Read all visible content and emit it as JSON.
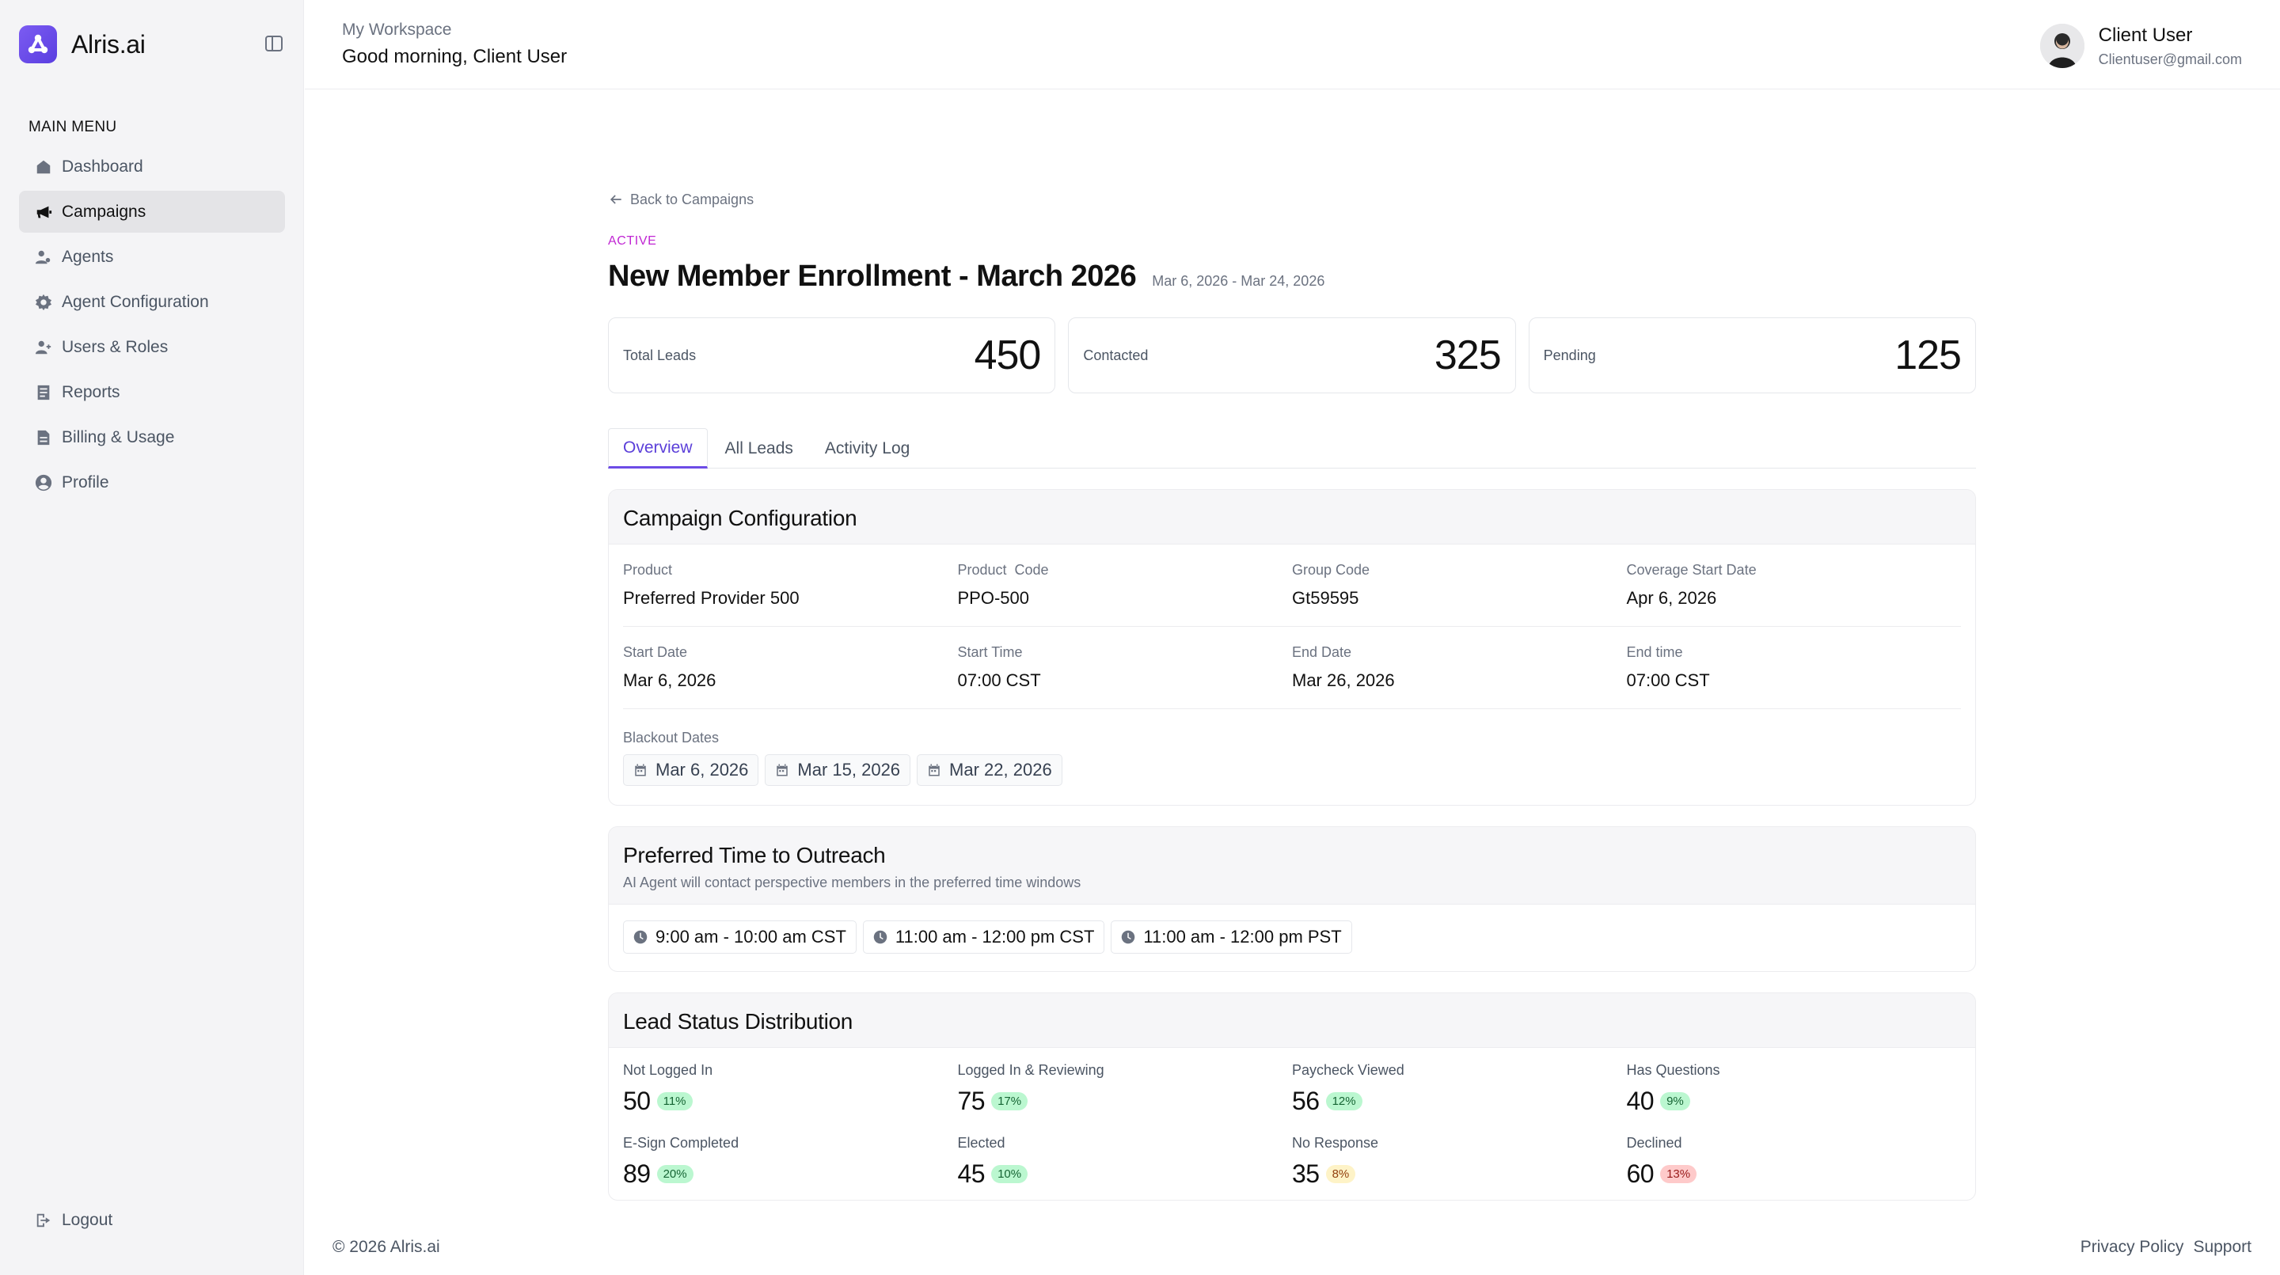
{
  "brand": {
    "name": "Alris.ai",
    "logo_icon": "triangle-dots-icon",
    "accent": "#6d4ce6"
  },
  "sidebar": {
    "menu_title": "MAIN MENU",
    "items": [
      {
        "label": "Dashboard",
        "icon": "home-icon"
      },
      {
        "label": "Campaigns",
        "icon": "megaphone-icon",
        "active": true
      },
      {
        "label": "Agents",
        "icon": "agents-icon"
      },
      {
        "label": "Agent Configuration",
        "icon": "gear-icon"
      },
      {
        "label": "Users & Roles",
        "icon": "users-icon"
      },
      {
        "label": "Reports",
        "icon": "report-icon"
      },
      {
        "label": "Billing & Usage",
        "icon": "billing-icon"
      },
      {
        "label": "Profile",
        "icon": "profile-icon"
      }
    ],
    "logout": "Logout"
  },
  "header": {
    "workspace": "My Workspace",
    "greeting": "Good morning, Client User",
    "user_name": "Client User",
    "user_email": "Clientuser@gmail.com"
  },
  "campaign": {
    "back": "Back to Campaigns",
    "status": "ACTIVE",
    "title": "New Member Enrollment - March 2026",
    "date_range": "Mar 6, 2026 - Mar 24, 2026",
    "stats": [
      {
        "label": "Total Leads",
        "value": "450"
      },
      {
        "label": "Contacted",
        "value": "325"
      },
      {
        "label": "Pending",
        "value": "125"
      }
    ],
    "tabs": [
      {
        "label": "Overview",
        "active": true
      },
      {
        "label": "All Leads"
      },
      {
        "label": "Activity Log"
      }
    ]
  },
  "config": {
    "title": "Campaign Configuration",
    "rows": [
      [
        {
          "label": "Product",
          "value": "Preferred Provider 500"
        },
        {
          "label": "Product  Code",
          "value": "PPO-500"
        },
        {
          "label": "Group Code",
          "value": "Gt59595"
        },
        {
          "label": "Coverage Start Date",
          "value": "Apr 6, 2026"
        }
      ],
      [
        {
          "label": "Start Date",
          "value": "Mar 6, 2026"
        },
        {
          "label": "Start Time",
          "value": "07:00 CST"
        },
        {
          "label": "End Date",
          "value": "Mar 26, 2026"
        },
        {
          "label": "End time",
          "value": "07:00 CST"
        }
      ]
    ],
    "blackout_label": "Blackout Dates",
    "blackout_dates": [
      "Mar 6, 2026",
      "Mar 15, 2026",
      "Mar 22, 2026"
    ]
  },
  "outreach": {
    "title": "Preferred Time to Outreach",
    "subtitle": "AI Agent will contact perspective members in the preferred time windows",
    "slots": [
      "9:00 am - 10:00 am CST",
      "11:00 am - 12:00 pm CST",
      "11:00 am - 12:00 pm PST"
    ]
  },
  "distribution": {
    "title": "Lead Status Distribution",
    "items": [
      {
        "label": "Not Logged In",
        "value": "50",
        "pct": "11%",
        "tone": "green"
      },
      {
        "label": "Logged In & Reviewing",
        "value": "75",
        "pct": "17%",
        "tone": "green"
      },
      {
        "label": "Paycheck Viewed",
        "value": "56",
        "pct": "12%",
        "tone": "green"
      },
      {
        "label": "Has Questions",
        "value": "40",
        "pct": "9%",
        "tone": "green"
      },
      {
        "label": "E-Sign Completed",
        "value": "89",
        "pct": "20%",
        "tone": "green"
      },
      {
        "label": "Elected",
        "value": "45",
        "pct": "10%",
        "tone": "green"
      },
      {
        "label": "No Response",
        "value": "35",
        "pct": "8%",
        "tone": "yellow"
      },
      {
        "label": "Declined",
        "value": "60",
        "pct": "13%",
        "tone": "red"
      }
    ]
  },
  "footer": {
    "copyright": "© 2026 Alris.ai",
    "privacy": "Privacy Policy",
    "support": "Support"
  }
}
